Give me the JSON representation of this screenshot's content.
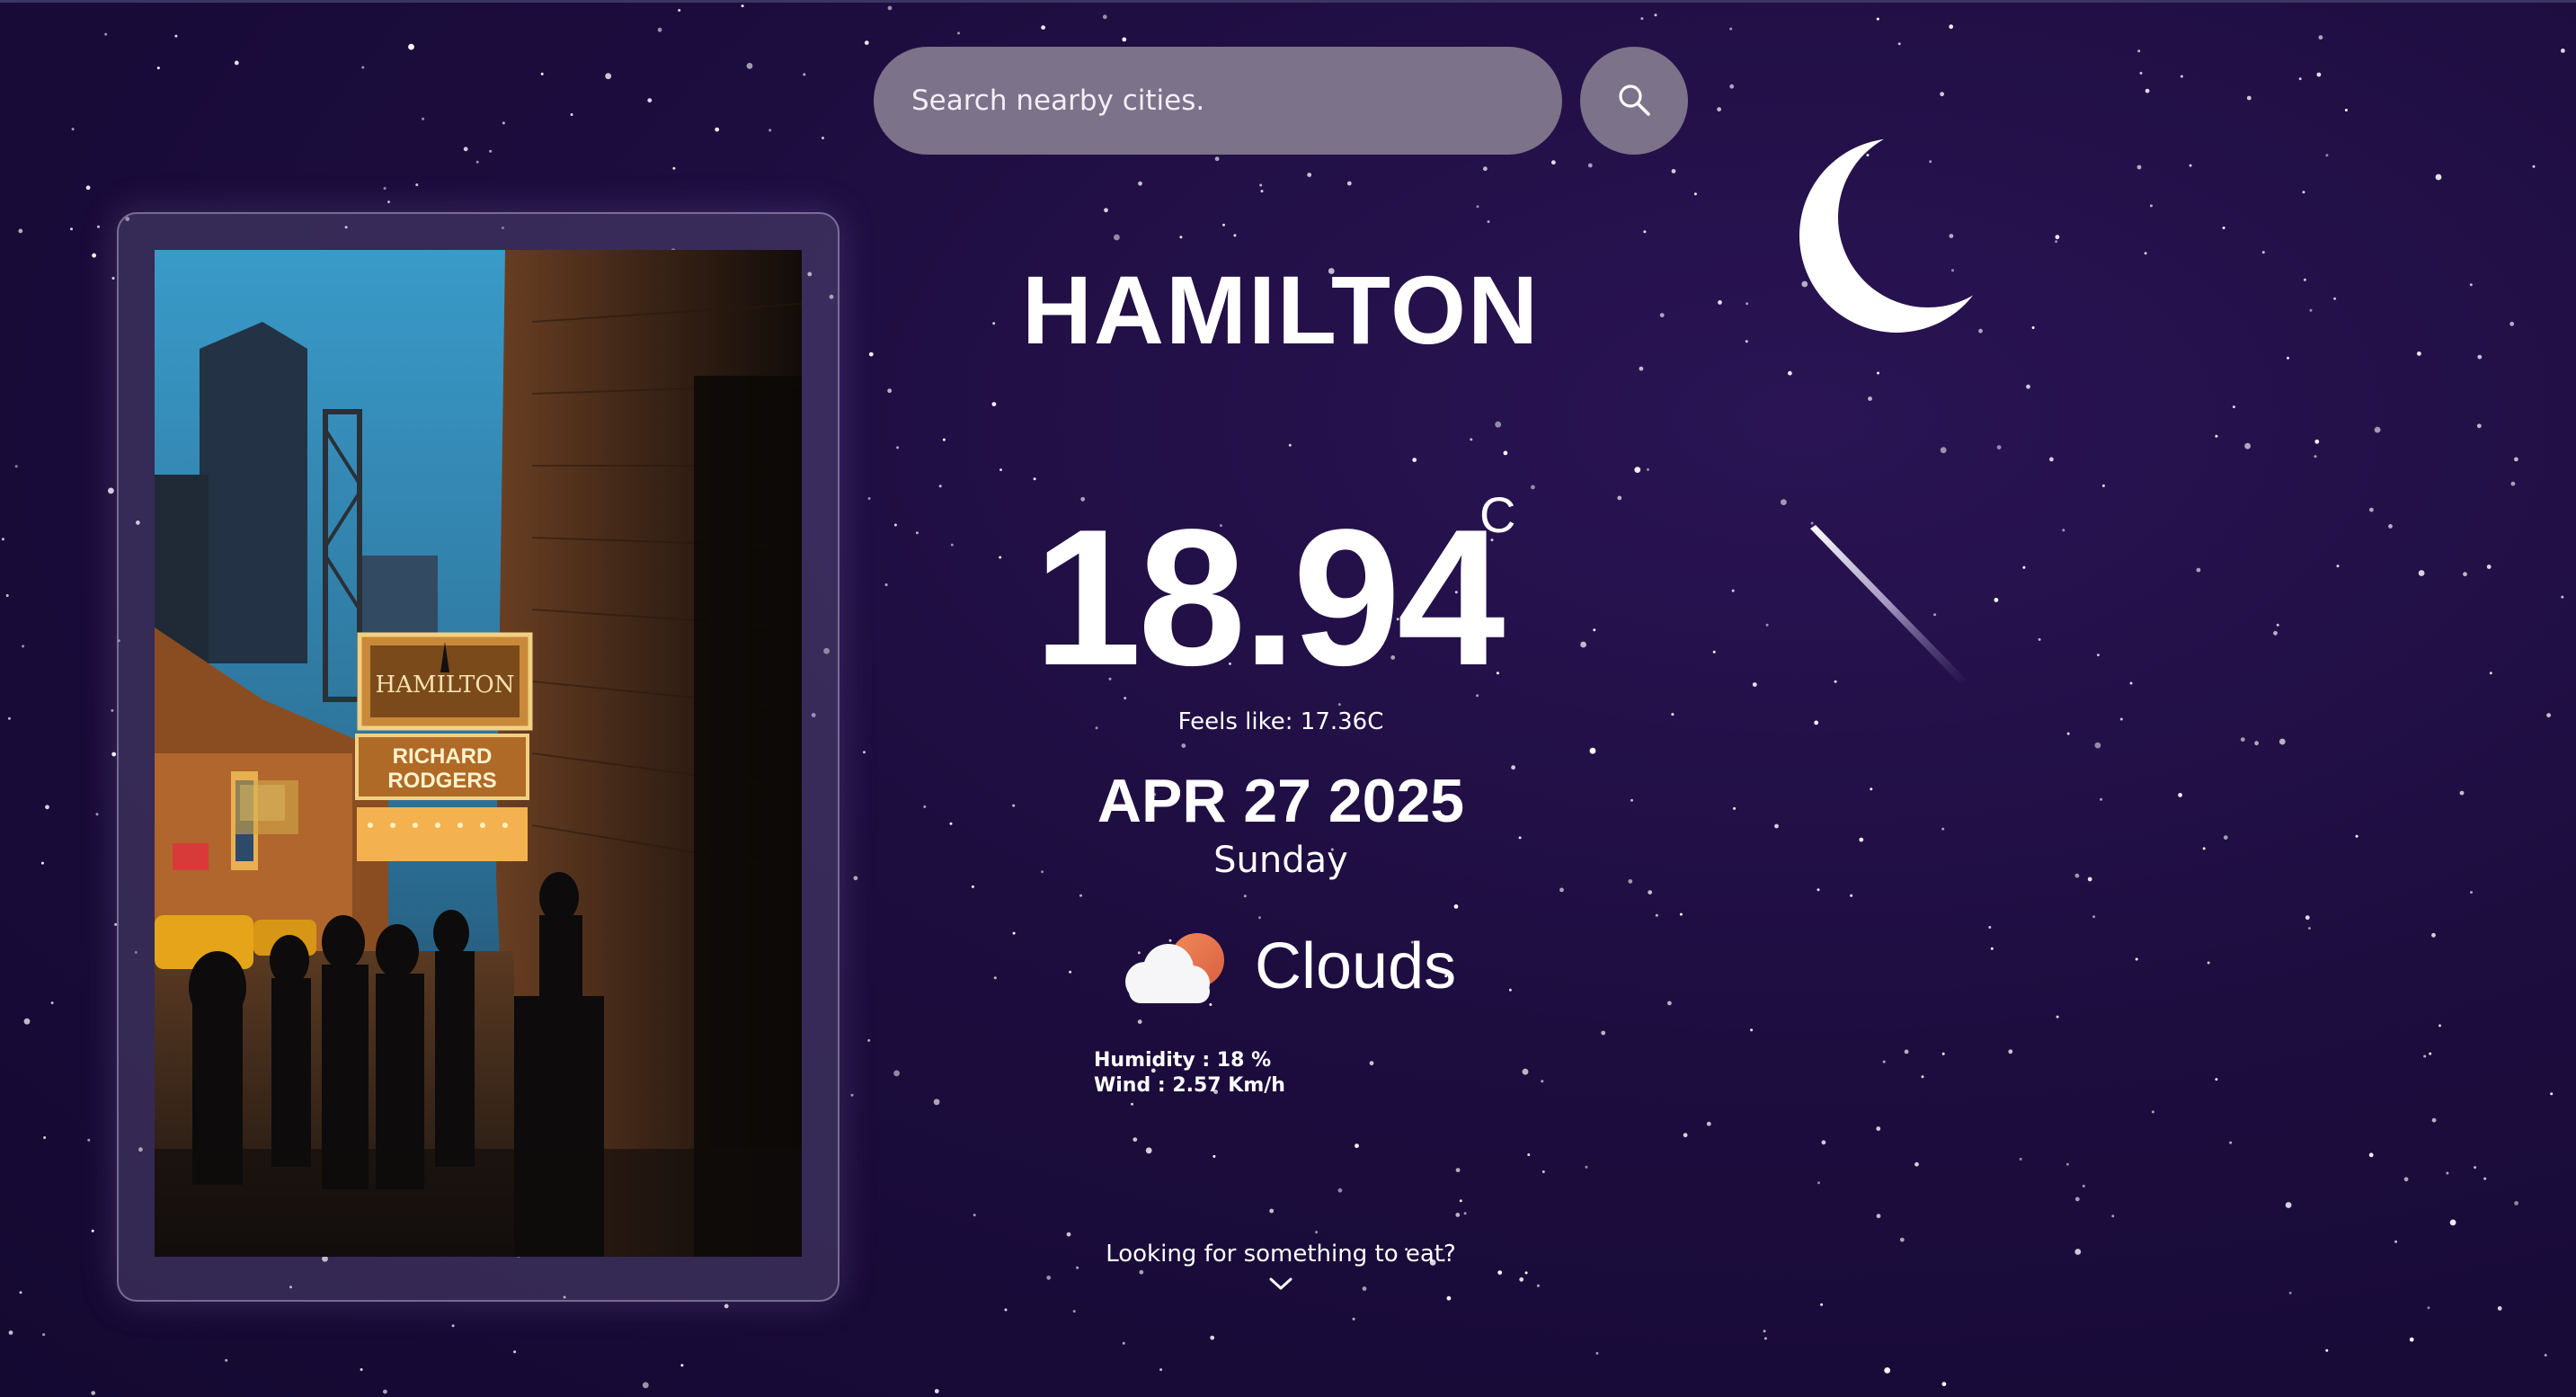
{
  "search": {
    "placeholder": "Search nearby cities.",
    "button_icon": "search-icon"
  },
  "city": "HAMILTON",
  "weather": {
    "temperature": "18.94",
    "unit": "C",
    "feels_like": "Feels like: 17.36C",
    "date": "APR 27 2025",
    "day": "Sunday",
    "condition": "Clouds",
    "condition_icon": "cloud-sun-icon",
    "humidity": "Humidity : 18 %",
    "wind": "Wind : 2.57 Km/h"
  },
  "food_prompt": "Looking for something to eat?",
  "photo_text": {
    "marquee": "HAMILTON",
    "sign_line1": "RICHARD",
    "sign_line2": "RODGERS"
  },
  "colors": {
    "background": "#1d0d3f",
    "search_fill": "#7c7289",
    "text": "#ffffff"
  }
}
